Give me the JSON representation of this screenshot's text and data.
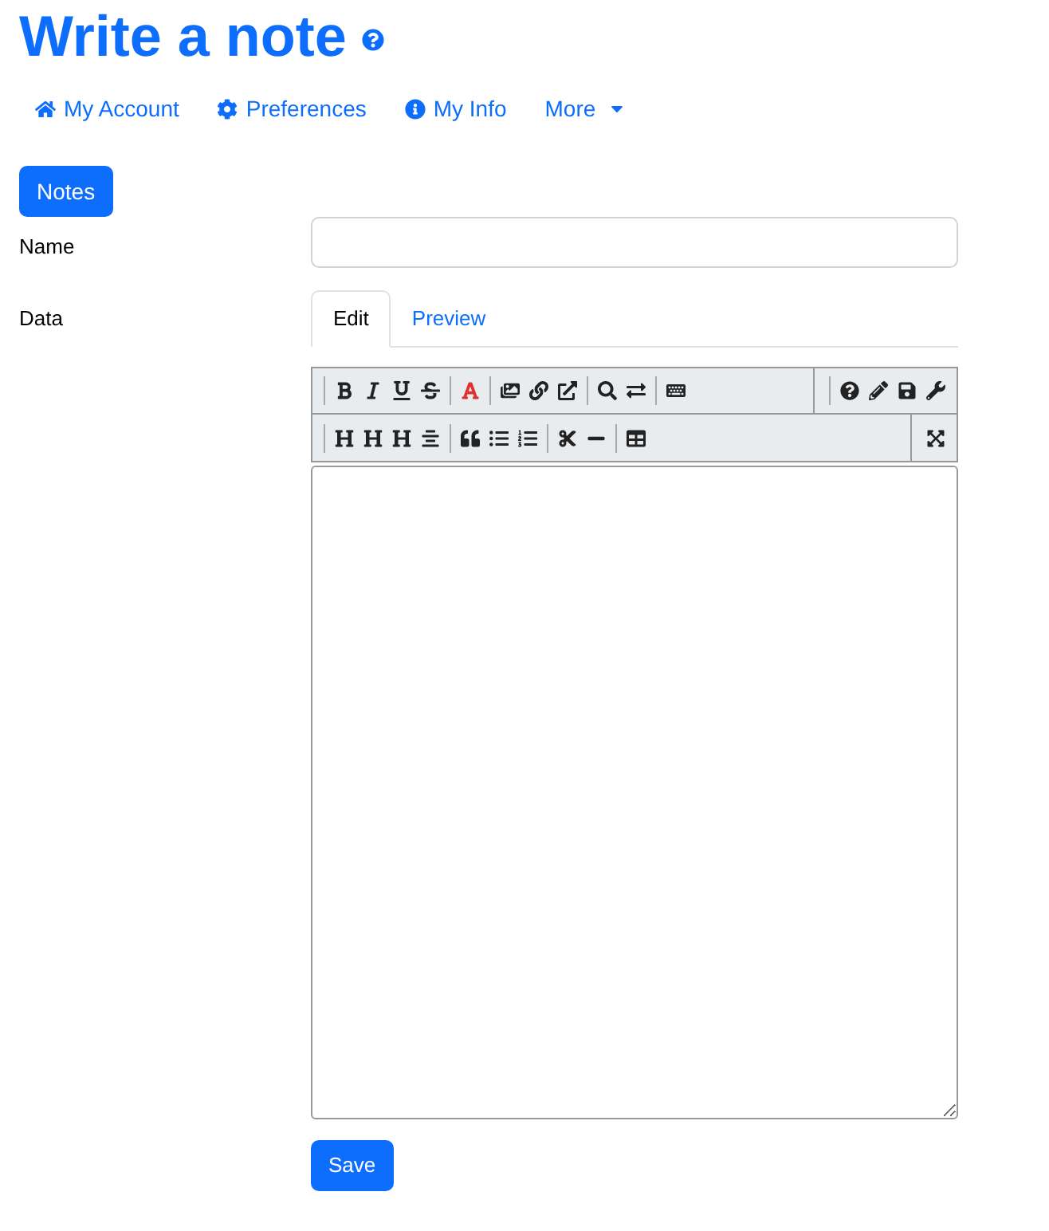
{
  "title": "Write a note",
  "nav": [
    {
      "label": "My Account",
      "kind": "home"
    },
    {
      "label": "Preferences",
      "kind": "gear"
    },
    {
      "label": "My Info",
      "kind": "info"
    },
    {
      "label": "More",
      "kind": "dropdown"
    }
  ],
  "section_button": "Notes",
  "fields": [
    {
      "label": "Name"
    },
    {
      "label": "Data"
    }
  ],
  "tabs": [
    {
      "label": "Edit",
      "selected": true
    },
    {
      "label": "Preview",
      "selected": false
    }
  ],
  "save_button": "Save"
}
